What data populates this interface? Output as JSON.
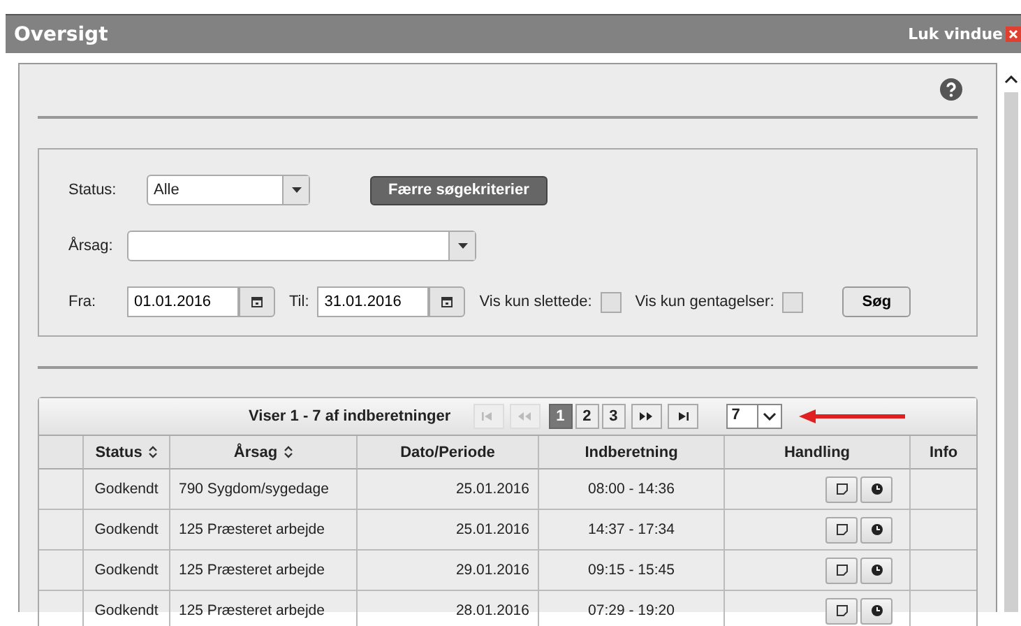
{
  "window": {
    "title": "Oversigt",
    "close_label": "Luk vindue"
  },
  "search": {
    "status": {
      "label": "Status:",
      "value": "Alle"
    },
    "more_button": "Færre søgekriterier",
    "reason": {
      "label": "Årsag:"
    },
    "from": {
      "label": "Fra:",
      "value": "01.01.2016"
    },
    "to": {
      "label": "Til:",
      "value": "31.01.2016"
    },
    "checks": [
      {
        "label": "Vis kun slettede:",
        "checked": false
      },
      {
        "label": "Vis kun gentagelser:",
        "checked": false
      }
    ],
    "search_button": "Søg"
  },
  "table": {
    "summary": "Viser 1 - 7 af indberetninger",
    "nav_start": [
      {
        "kind": "first",
        "disabled": true
      },
      {
        "kind": "prev",
        "disabled": true
      }
    ],
    "pages": [
      {
        "label": "1",
        "selected": true
      },
      {
        "label": "2",
        "selected": false
      },
      {
        "label": "3",
        "selected": false
      }
    ],
    "nav_end": [
      {
        "kind": "next",
        "disabled": false
      },
      {
        "kind": "last",
        "disabled": false
      }
    ],
    "page_size": "7",
    "columns": [
      {
        "label": "Status",
        "sortable": true
      },
      {
        "label": "Årsag",
        "sortable": true
      },
      {
        "label": "Dato/Periode",
        "sortable": false
      },
      {
        "label": "Indberetning",
        "sortable": false
      },
      {
        "label": "Handling",
        "sortable": false
      },
      {
        "label": "Info",
        "sortable": false
      }
    ],
    "rows": [
      {
        "status": "Godkendt",
        "reason": "790 Sygdom/sygedage",
        "date": "25.01.2016",
        "time": "08:00 - 14:36"
      },
      {
        "status": "Godkendt",
        "reason": "125 Præsteret arbejde",
        "date": "25.01.2016",
        "time": "14:37 - 17:34"
      },
      {
        "status": "Godkendt",
        "reason": "125 Præsteret arbejde",
        "date": "29.01.2016",
        "time": "09:15 - 15:45"
      },
      {
        "status": "Godkendt",
        "reason": "125 Præsteret arbejde",
        "date": "28.01.2016",
        "time": "07:29 - 19:20"
      }
    ]
  }
}
